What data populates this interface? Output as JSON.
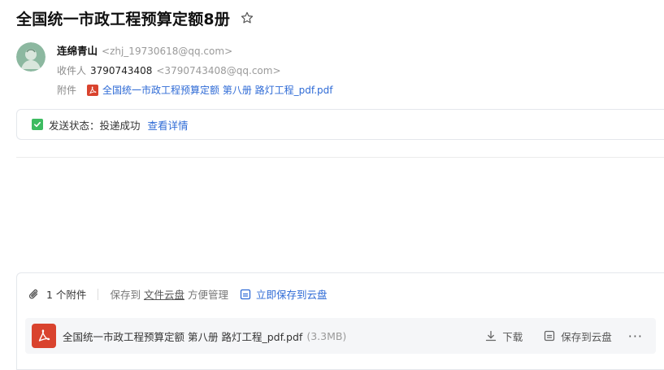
{
  "mail": {
    "subject": "全国统一市政工程预算定额8册",
    "sender": {
      "name": "连绵青山",
      "email": "<zhj_19730618@qq.com>"
    },
    "recipient": {
      "label": "收件人",
      "name": "3790743408",
      "email": "<3790743408@qq.com>"
    },
    "attachment_line": {
      "label": "附件",
      "filename": "全国统一市政工程预算定额 第八册 路灯工程_pdf.pdf"
    }
  },
  "status": {
    "text": "发送状态：投递成功",
    "detail_link": "查看详情"
  },
  "attachments_panel": {
    "count_label": "1 个附件",
    "save_prefix": "保存到",
    "save_link": "文件云盘",
    "save_suffix": "方便管理",
    "save_now": "立即保存到云盘",
    "files": [
      {
        "name": "全国统一市政工程预算定额 第八册 路灯工程_pdf.pdf",
        "size": "(3.3MB)",
        "download_label": "下载",
        "save_label": "保存到云盘",
        "more_label": "···"
      }
    ]
  },
  "colors": {
    "link": "#2f6bd6",
    "pdf_red": "#d9432e",
    "success_green": "#3dbb61"
  },
  "icons": [
    "star-icon",
    "avatar",
    "pdf-icon",
    "check-icon",
    "paperclip-icon",
    "cloud-save-icon",
    "download-icon",
    "save-cloud-icon",
    "more-icon"
  ]
}
